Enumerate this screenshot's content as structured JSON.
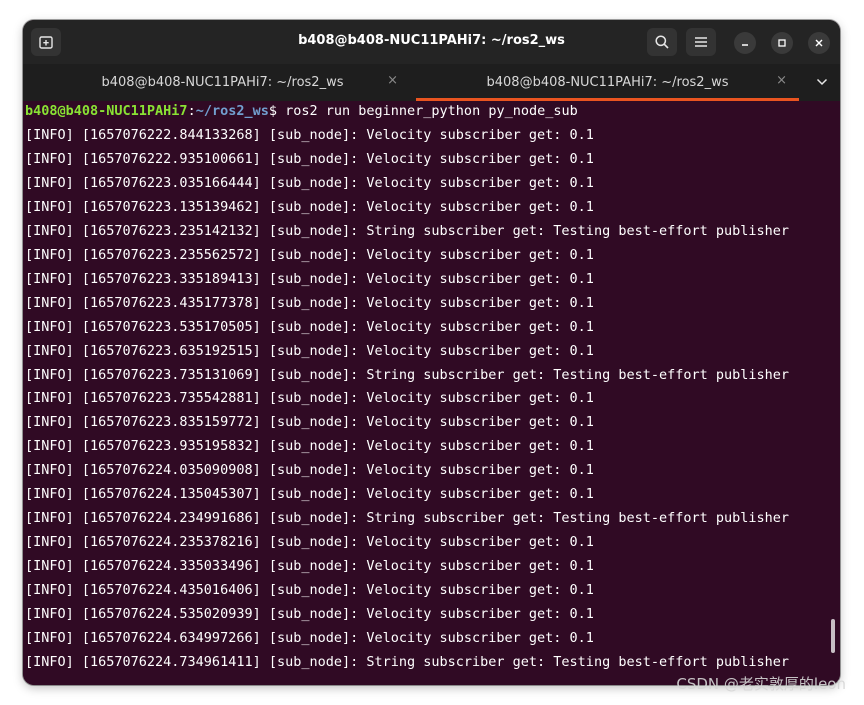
{
  "window": {
    "title": "b408@b408-NUC11PAHi7: ~/ros2_ws"
  },
  "tabs": [
    {
      "label": "b408@b408-NUC11PAHi7: ~/ros2_ws",
      "close": "×",
      "active": false
    },
    {
      "label": "b408@b408-NUC11PAHi7: ~/ros2_ws",
      "close": "×",
      "active": true
    }
  ],
  "icons": {
    "new_tab": "new-tab-icon",
    "search": "search-icon",
    "menu": "hamburger-menu-icon",
    "minimize": "minimize-icon",
    "maximize": "maximize-icon",
    "close": "close-icon",
    "tab_dropdown": "chevron-down-icon"
  },
  "colors": {
    "terminal_bg": "#300a24",
    "prompt_user": "#8ae234",
    "prompt_path": "#729fcf",
    "tab_accent": "#e95420",
    "titlebar_bg": "#242424"
  },
  "terminal": {
    "prompt": {
      "user_host": "b408@b408-NUC11PAHi7",
      "sep": ":",
      "path": "~/ros2_ws",
      "symbol": "$",
      "command": " ros2 run beginner_python py_node_sub"
    },
    "lines": [
      "[INFO] [1657076222.844133268] [sub_node]: Velocity subscriber get: 0.1",
      "[INFO] [1657076222.935100661] [sub_node]: Velocity subscriber get: 0.1",
      "[INFO] [1657076223.035166444] [sub_node]: Velocity subscriber get: 0.1",
      "[INFO] [1657076223.135139462] [sub_node]: Velocity subscriber get: 0.1",
      "[INFO] [1657076223.235142132] [sub_node]: String subscriber get: Testing best-effort publisher",
      "[INFO] [1657076223.235562572] [sub_node]: Velocity subscriber get: 0.1",
      "[INFO] [1657076223.335189413] [sub_node]: Velocity subscriber get: 0.1",
      "[INFO] [1657076223.435177378] [sub_node]: Velocity subscriber get: 0.1",
      "[INFO] [1657076223.535170505] [sub_node]: Velocity subscriber get: 0.1",
      "[INFO] [1657076223.635192515] [sub_node]: Velocity subscriber get: 0.1",
      "[INFO] [1657076223.735131069] [sub_node]: String subscriber get: Testing best-effort publisher",
      "[INFO] [1657076223.735542881] [sub_node]: Velocity subscriber get: 0.1",
      "[INFO] [1657076223.835159772] [sub_node]: Velocity subscriber get: 0.1",
      "[INFO] [1657076223.935195832] [sub_node]: Velocity subscriber get: 0.1",
      "[INFO] [1657076224.035090908] [sub_node]: Velocity subscriber get: 0.1",
      "[INFO] [1657076224.135045307] [sub_node]: Velocity subscriber get: 0.1",
      "[INFO] [1657076224.234991686] [sub_node]: String subscriber get: Testing best-effort publisher",
      "[INFO] [1657076224.235378216] [sub_node]: Velocity subscriber get: 0.1",
      "[INFO] [1657076224.335033496] [sub_node]: Velocity subscriber get: 0.1",
      "[INFO] [1657076224.435016406] [sub_node]: Velocity subscriber get: 0.1",
      "[INFO] [1657076224.535020939] [sub_node]: Velocity subscriber get: 0.1",
      "[INFO] [1657076224.634997266] [sub_node]: Velocity subscriber get: 0.1",
      "[INFO] [1657076224.734961411] [sub_node]: String subscriber get: Testing best-effort publisher"
    ]
  },
  "watermark": "CSDN @老实敦厚的leon"
}
